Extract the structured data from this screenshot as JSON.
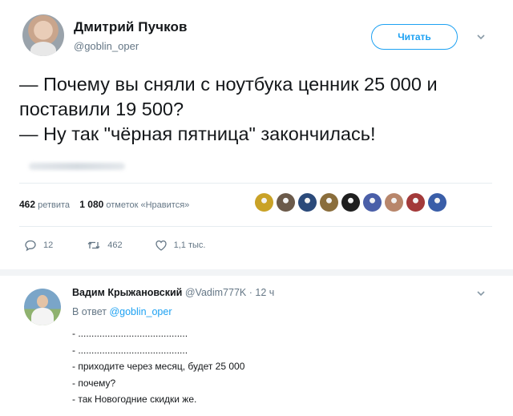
{
  "tweet": {
    "author_name": "Дмитрий Пучков",
    "author_handle": "@goblin_oper",
    "follow_label": "Читать",
    "text_lines": [
      "— Почему вы сняли с ноутбука ценник 25 000 и поставили 19 500?",
      "— Ну так \"чёрная пятница\" закончилась!"
    ],
    "retweets_count": "462",
    "retweets_label": "ретвита",
    "likes_count": "1 080",
    "likes_label": "отметок «Нравится»",
    "actions": {
      "replies": "12",
      "retweets": "462",
      "likes": "1,1 тыс."
    },
    "liker_colors": [
      "#c9a227",
      "#6b5a4a",
      "#2b4a7a",
      "#8a6d3b",
      "#1f1f1f",
      "#4a5fa8",
      "#b8866b",
      "#a33a3a",
      "#3a5ea8"
    ]
  },
  "reply": {
    "author_name": "Вадим Крыжановский",
    "author_handle": "@Vadim777K",
    "time": "· 12 ч",
    "in_reply_prefix": "В ответ",
    "in_reply_mention": "@goblin_oper",
    "lines": [
      "- .........................................",
      "- .........................................",
      "- приходите через месяц, будет 25 000",
      "- почему?",
      "- так Новогодние скидки же."
    ]
  },
  "colors": {
    "accent": "#1da1f2",
    "muted": "#657786",
    "text": "#14171a"
  }
}
